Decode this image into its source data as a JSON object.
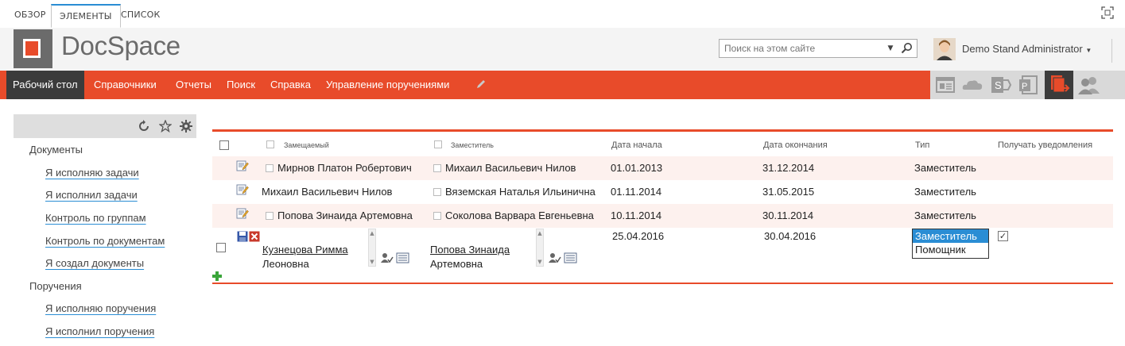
{
  "ribbon": {
    "tabs": [
      "ОБЗОР",
      "ЭЛЕМЕНТЫ",
      "СПИСОК"
    ],
    "active_tab": "ЭЛЕМЕНТЫ"
  },
  "header": {
    "logo_text": "DocSpace",
    "search_placeholder": "Поиск на этом сайте",
    "user_name": "Demo Stand Administrator"
  },
  "nav": {
    "items": [
      "Рабочий стол",
      "Справочники",
      "Отчеты",
      "Поиск",
      "Справка",
      "Управление поручениями"
    ],
    "active": "Рабочий стол",
    "app_icons": [
      "newsfeed-icon",
      "onedrive-icon",
      "sharepoint-icon",
      "project-icon",
      "workflow-icon",
      "people-icon"
    ]
  },
  "sidebar": {
    "groups": [
      {
        "title": "Документы",
        "links": [
          "Я исполняю задачи",
          "Я исполнил задачи",
          "Контроль по группам",
          "Контроль по документам",
          "Я создал документы"
        ]
      },
      {
        "title": "Поручения",
        "links": [
          "Я исполняю поручения",
          "Я исполнил поручения"
        ]
      }
    ]
  },
  "grid": {
    "columns": [
      "Замещаемый",
      "Заместитель",
      "Дата начала",
      "Дата окончания",
      "Тип",
      "Получать уведомления"
    ],
    "rows": [
      {
        "replaced": "Мирнов Платон Робертович",
        "deputy": "Михаил Васильевич Нилов",
        "start": "01.01.2013",
        "end": "31.12.2014",
        "type": "Заместитель"
      },
      {
        "replaced": "Михаил Васильевич Нилов",
        "deputy": "Вяземская Наталья Ильинична",
        "start": "01.11.2014",
        "end": "31.05.2015",
        "type": "Заместитель"
      },
      {
        "replaced": "Попова Зинаида Артемовна",
        "deputy": "Соколова Варвара Евгеньевна",
        "start": "10.11.2014",
        "end": "30.11.2014",
        "type": "Заместитель"
      }
    ],
    "edit_row": {
      "replaced_line1": "Кузнецова Римма",
      "replaced_line2": "Леоновна",
      "deputy_line1": "Попова Зинаида",
      "deputy_line2": "Артемовна",
      "start": "25.04.2016",
      "end": "30.04.2016",
      "type_options": [
        "Заместитель",
        "Помощник"
      ],
      "type_selected": "Заместитель",
      "notify_checked": true
    }
  }
}
